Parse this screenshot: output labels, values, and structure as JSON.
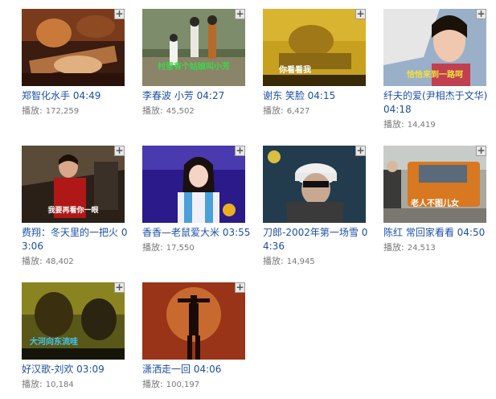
{
  "colors": {
    "link": "#1c4fa6",
    "meta": "#777777"
  },
  "add_icon": "plus-icon",
  "plays_label": "播放:",
  "videos": [
    {
      "title": "郑智化水手",
      "duration": "04:49",
      "plays": "172,259",
      "caption": ""
    },
    {
      "title": "李春波 小芳",
      "duration": "04:27",
      "plays": "45,502",
      "caption": "村里有个姑娘叫小芳"
    },
    {
      "title": "谢东 笑脸",
      "duration": "04:15",
      "plays": "6,427",
      "caption": "你看看我"
    },
    {
      "title": "纤夫的爱(尹相杰于文华)",
      "duration": "04:18",
      "plays": "14,419",
      "caption": "恰恰来到一路呵"
    },
    {
      "title": "费翔：冬天里的一把火",
      "duration": "03:06",
      "plays": "48,402",
      "caption": "我要再看你一眼"
    },
    {
      "title": "香香—老鼠爱大米",
      "duration": "03:55",
      "plays": "17,550",
      "caption": ""
    },
    {
      "title": "刀郎-2002年第一场雪",
      "duration": "04:36",
      "plays": "14,945",
      "caption": ""
    },
    {
      "title": "陈红 常回家看看",
      "duration": "04:50",
      "plays": "24,513",
      "caption": "老人不图儿女"
    },
    {
      "title": "好汉歌-刘欢",
      "duration": "03:09",
      "plays": "10,184",
      "caption": "大河向东流哇"
    },
    {
      "title": "潇洒走一回",
      "duration": "04:06",
      "plays": "100,197",
      "caption": ""
    }
  ]
}
